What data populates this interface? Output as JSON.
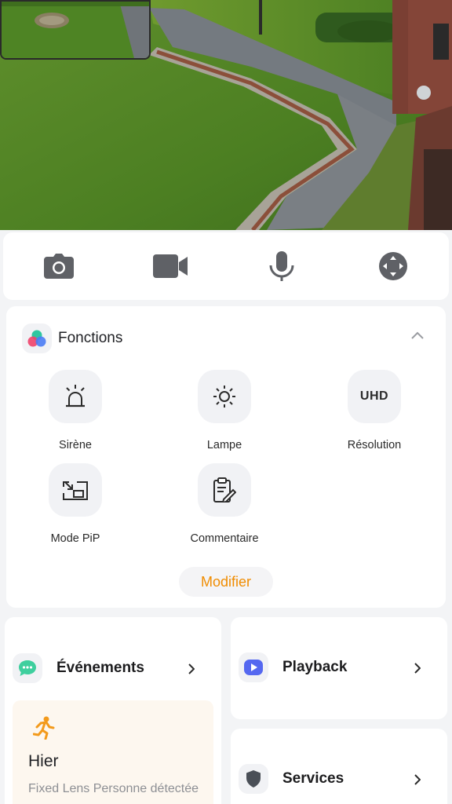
{
  "colors": {
    "accent": "#f08c00",
    "background": "#f3f4f6",
    "card": "#ffffff",
    "tile": "#f1f2f5",
    "event_bg": "#fdf7ef"
  },
  "camera": {
    "main_feed": "garden-camera-feed",
    "pip_feed": "pip-camera-feed"
  },
  "controls": [
    {
      "icon": "camera-icon"
    },
    {
      "icon": "video-record-icon"
    },
    {
      "icon": "microphone-icon"
    },
    {
      "icon": "ptz-joystick-icon"
    }
  ],
  "fonctions": {
    "title": "Fonctions",
    "items": [
      {
        "label": "Sirène",
        "icon": "siren-icon"
      },
      {
        "label": "Lampe",
        "icon": "lamp-icon"
      },
      {
        "label": "Résolution",
        "icon": "uhd-icon",
        "badge": "UHD"
      },
      {
        "label": "Mode PiP",
        "icon": "pip-mode-icon"
      },
      {
        "label": "Commentaire",
        "icon": "comment-clipboard-icon"
      }
    ],
    "modify_label": "Modifier"
  },
  "events": {
    "title": "Événements",
    "latest": {
      "day": "Hier",
      "description": "Fixed Lens Personne détectée"
    }
  },
  "playback": {
    "title": "Playback"
  },
  "services": {
    "title": "Services"
  }
}
